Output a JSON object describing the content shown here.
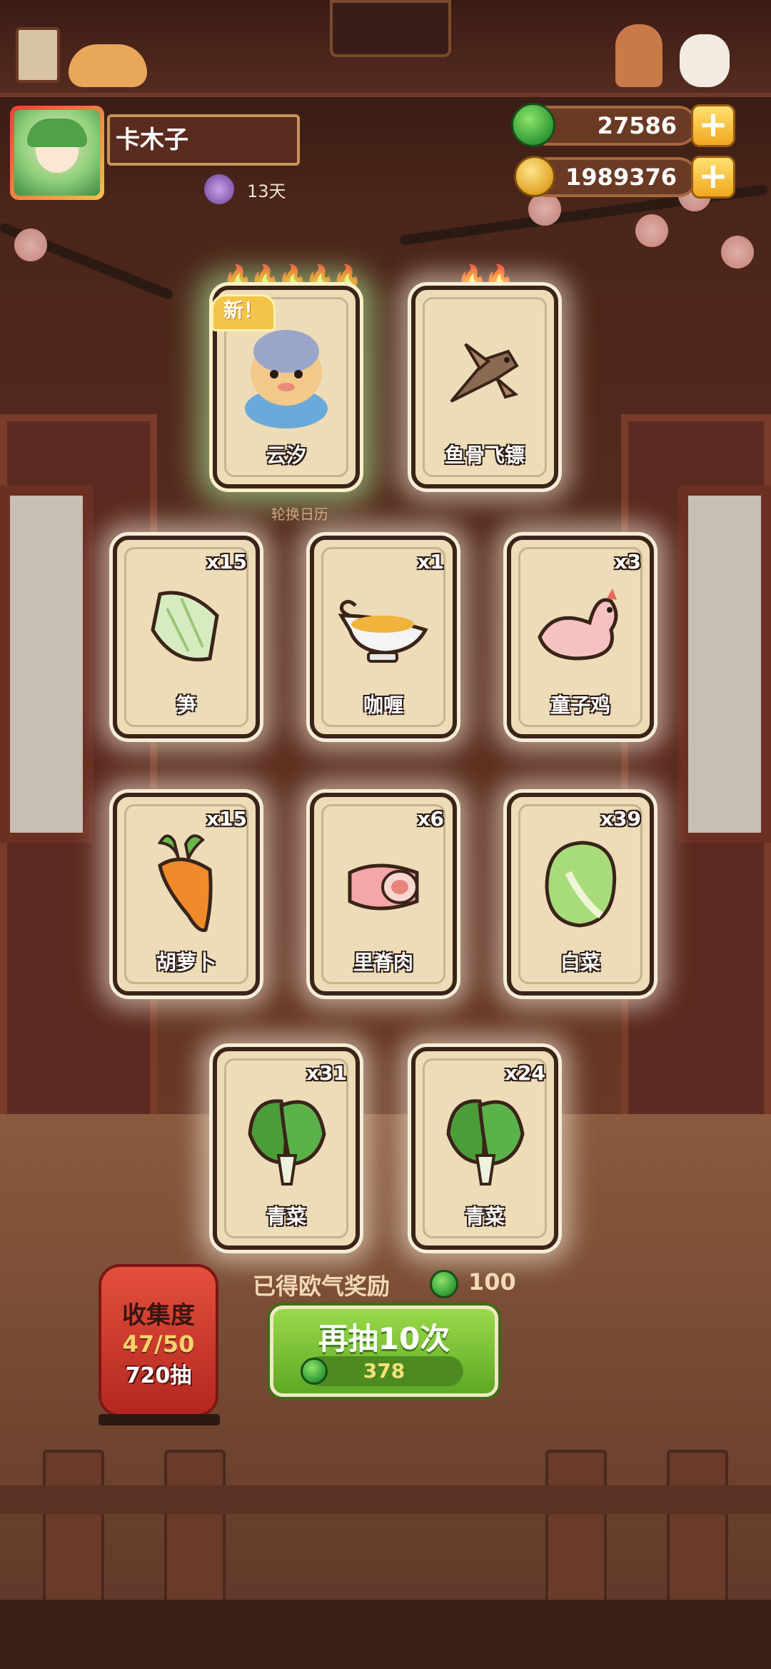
{
  "player": {
    "name": "卡木子",
    "days": "13天"
  },
  "currency": {
    "jade": "27586",
    "gold": "1989376",
    "add_label": "+"
  },
  "featured_cards": [
    {
      "name": "云汐",
      "badge": "新！"
    },
    {
      "name": "鱼骨飞镖"
    }
  ],
  "calendar_label": "轮换日历",
  "cards": [
    {
      "name": "笋",
      "count": "x15",
      "icon": "bamboo-shoot-icon"
    },
    {
      "name": "咖喱",
      "count": "x1",
      "icon": "curry-gravy-boat-icon"
    },
    {
      "name": "童子鸡",
      "count": "x3",
      "icon": "chicken-icon"
    },
    {
      "name": "胡萝卜",
      "count": "x15",
      "icon": "carrot-icon"
    },
    {
      "name": "里脊肉",
      "count": "x6",
      "icon": "tenderloin-meat-icon"
    },
    {
      "name": "白菜",
      "count": "x39",
      "icon": "napa-cabbage-icon"
    },
    {
      "name": "青菜",
      "count": "x31",
      "icon": "bok-choy-icon"
    },
    {
      "name": "青菜",
      "count": "x24",
      "icon": "bok-choy-icon"
    }
  ],
  "collection": {
    "title": "收集度",
    "progress": "47/50",
    "draws": "720抽"
  },
  "reward": {
    "label": "已得欧气奖励",
    "value": "100"
  },
  "draw_button": {
    "label": "再抽10次",
    "cost": "378"
  },
  "colors": {
    "jade_green": "#2f9a35",
    "gold": "#e0a526",
    "button_green": "#7cc23a",
    "lantern_red": "#c9362a"
  }
}
